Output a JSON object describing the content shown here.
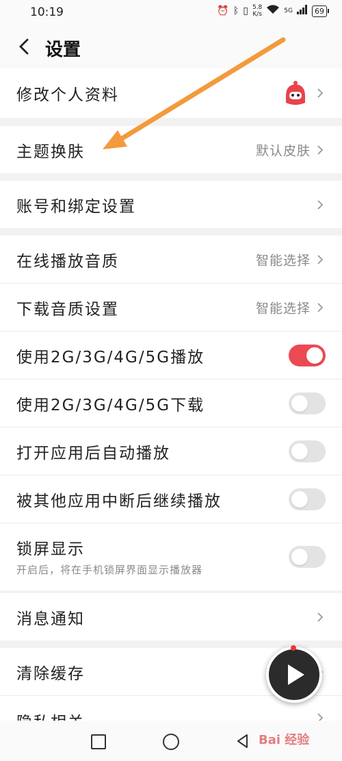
{
  "status": {
    "time": "10:19",
    "net_speed_value": "5.8",
    "net_speed_unit": "K/s",
    "signal_label": "5G",
    "battery": "69"
  },
  "header": {
    "title": "设置",
    "back_icon": "chevron-left-icon"
  },
  "groups": [
    {
      "items": [
        {
          "label": "修改个人资料",
          "type": "avatar"
        }
      ]
    },
    {
      "items": [
        {
          "label": "主题换肤",
          "value": "默认皮肤",
          "type": "link"
        }
      ]
    },
    {
      "items": [
        {
          "label": "账号和绑定设置",
          "type": "link"
        }
      ]
    },
    {
      "items": [
        {
          "label": "在线播放音质",
          "value": "智能选择",
          "type": "link"
        },
        {
          "label": "下载音质设置",
          "value": "智能选择",
          "type": "link"
        },
        {
          "label": "使用2G/3G/4G/5G播放",
          "type": "toggle",
          "on": true
        },
        {
          "label": "使用2G/3G/4G/5G下载",
          "type": "toggle",
          "on": false
        },
        {
          "label": "打开应用后自动播放",
          "type": "toggle",
          "on": false
        },
        {
          "label": "被其他应用中断后继续播放",
          "type": "toggle",
          "on": false
        },
        {
          "label": "锁屏显示",
          "sub": "开启后，将在手机锁屏界面显示播放器",
          "type": "toggle",
          "on": false
        }
      ]
    },
    {
      "items": [
        {
          "label": "消息通知",
          "type": "link"
        }
      ]
    },
    {
      "items": [
        {
          "label": "清除缓存",
          "type": "link"
        },
        {
          "label": "隐私相关",
          "type": "link"
        }
      ]
    }
  ],
  "watermark": "Bai 经验",
  "colors": {
    "accent": "#ec4a53",
    "annotation_arrow": "#f39a3c",
    "background": "#f2f2f2"
  }
}
